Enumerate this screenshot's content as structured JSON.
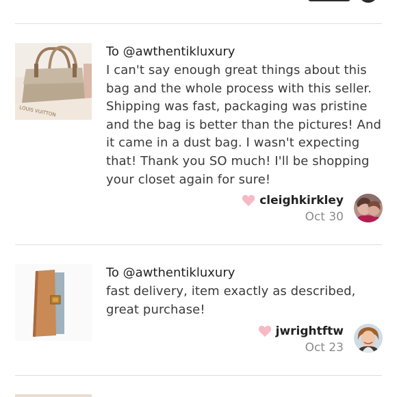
{
  "reviews": [
    {
      "to": "To @awthentikluxury",
      "text": "I can't say enough great things about this bag and the whole process with this seller. Shipping was fast, packaging was pristine and the bag is better than the pictures! And it came in a dust bag. I wasn't expecting that! Thank you SO much! I'll be shopping your closet again for sure!",
      "author": "cleighkirkley",
      "date": "Oct 30",
      "thumb_text": "LOUIS VUITTON",
      "thumb_icon": "tote-bag-photo",
      "avatar_icon": "user-avatar-photo"
    },
    {
      "to": "To @awthentikluxury",
      "text": "fast delivery, item exactly as described, great purchase!",
      "author": "jwrightftw",
      "date": "Oct 23",
      "thumb_icon": "agenda-cover-photo",
      "avatar_icon": "user-avatar-photo"
    }
  ],
  "colors": {
    "heart": "#f7b9c4",
    "divider": "#dddddd",
    "date": "#8a8a8a"
  }
}
